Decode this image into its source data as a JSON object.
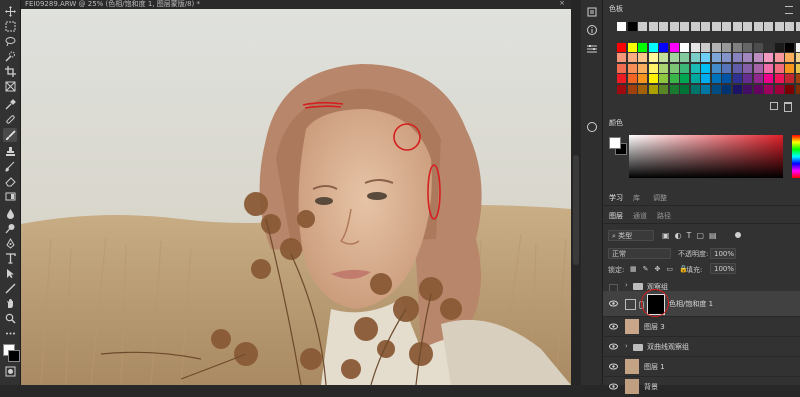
{
  "document": {
    "tab_title": "FEI09289.ARW @ 25% (色相/饱和度 1, 图层蒙版/8) *",
    "close_label": "×"
  },
  "tools": [
    "move-tool",
    "marquee-tool",
    "lasso-tool",
    "quick-selection-tool",
    "crop-tool",
    "frame-tool",
    "eyedropper-tool",
    "spot-healing-tool",
    "brush-tool",
    "clone-stamp-tool",
    "history-brush-tool",
    "eraser-tool",
    "gradient-tool",
    "blur-tool",
    "dodge-tool",
    "pen-tool",
    "type-tool",
    "path-selection-tool",
    "rectangle-tool",
    "hand-tool",
    "zoom-tool"
  ],
  "swatches_panel": {
    "title": "色板",
    "colors": {
      "foreground": "#ffffff",
      "background": "#000000",
      "accent_red": "#e0202a",
      "panel_bg": "#323232",
      "annotation_red": "#d42020"
    }
  },
  "color_panel": {
    "title": "颜色"
  },
  "panel_tabs": {
    "learn": "学习",
    "library": "库",
    "adjust": "调整"
  },
  "layers_tabs": {
    "layers": "图层",
    "channels": "通道",
    "paths": "路径"
  },
  "layers_controls": {
    "filter_kind": "类型",
    "blend_mode": "正常",
    "opacity_label": "不透明度:",
    "opacity_value": "100%",
    "lock_label": "锁定:",
    "fill_label": "填充:",
    "fill_value": "100%"
  },
  "layers": [
    {
      "name": "观察组",
      "type": "group",
      "visible": false
    },
    {
      "name": "色相/饱和度 1",
      "type": "adjustment",
      "visible": true,
      "selected": true
    },
    {
      "name": "图层 3",
      "type": "pixel",
      "visible": true
    },
    {
      "name": "双曲线观察组",
      "type": "group",
      "visible": true
    },
    {
      "name": "图层 1",
      "type": "pixel",
      "visible": true
    },
    {
      "name": "背景",
      "type": "pixel",
      "visible": true
    }
  ]
}
